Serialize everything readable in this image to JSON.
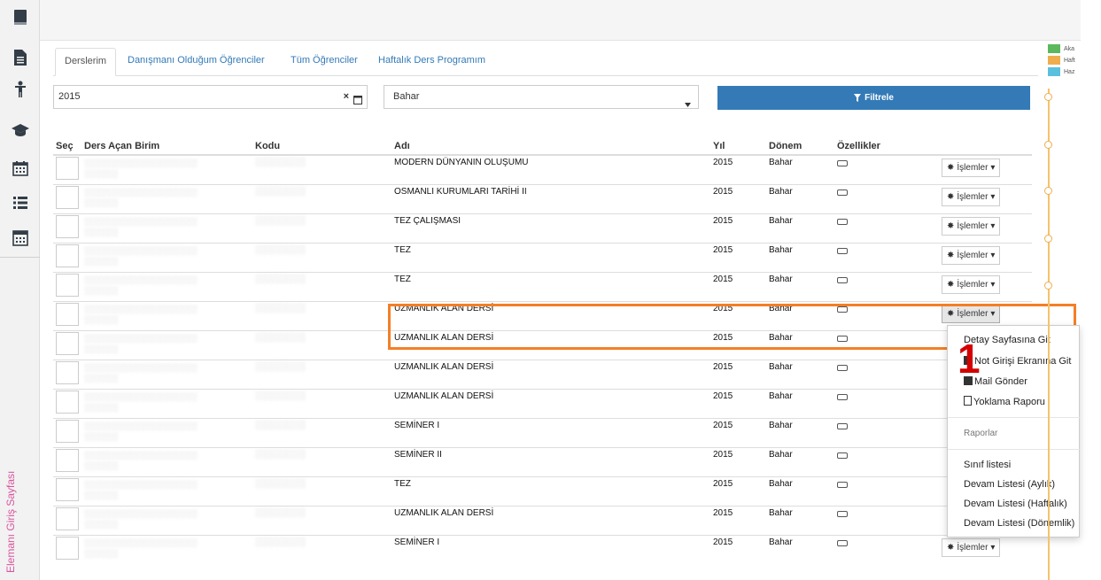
{
  "sidebar": {
    "icons": [
      "book-icon",
      "document-icon",
      "person-icon",
      "graduation-cap-icon",
      "calendar-icon",
      "list-icon",
      "calculator-icon"
    ],
    "vertical_label": "Elemanı Giriş Sayfası"
  },
  "tabs": [
    {
      "label": "Derslerim",
      "active": true
    },
    {
      "label": "Danışmanı Olduğum Öğrenciler",
      "active": false
    },
    {
      "label": "Tüm Öğrenciler",
      "active": false
    },
    {
      "label": "Haftalık Ders Programım",
      "active": false
    }
  ],
  "filters": {
    "year_value": "2015",
    "term_value": "Bahar",
    "filter_button_label": "Filtrele",
    "clear_symbol": "×"
  },
  "table": {
    "headers": {
      "select": "Seç",
      "unit": "Ders Açan Birim",
      "code": "Kodu",
      "name": "Adı",
      "year": "Yıl",
      "term": "Dönem",
      "features": "Özellikler"
    },
    "action_label": "İşlemler",
    "rows": [
      {
        "name": "MODERN DÜNYANIN OLUŞUMU",
        "year": "2015",
        "term": "Bahar",
        "show_action": true
      },
      {
        "name": "OSMANLI KURUMLARI TARİHİ II",
        "year": "2015",
        "term": "Bahar",
        "show_action": true
      },
      {
        "name": "TEZ ÇALIŞMASI",
        "year": "2015",
        "term": "Bahar",
        "show_action": true
      },
      {
        "name": "TEZ",
        "year": "2015",
        "term": "Bahar",
        "show_action": true
      },
      {
        "name": "TEZ",
        "year": "2015",
        "term": "Bahar",
        "show_action": true
      },
      {
        "name": "UZMANLIK ALAN DERSİ",
        "year": "2015",
        "term": "Bahar",
        "show_action": true,
        "open": true
      },
      {
        "name": "UZMANLIK ALAN DERSİ",
        "year": "2015",
        "term": "Bahar",
        "show_action": false
      },
      {
        "name": "UZMANLIK ALAN DERSİ",
        "year": "2015",
        "term": "Bahar",
        "show_action": false
      },
      {
        "name": "UZMANLIK ALAN DERSİ",
        "year": "2015",
        "term": "Bahar",
        "show_action": false
      },
      {
        "name": "SEMİNER I",
        "year": "2015",
        "term": "Bahar",
        "show_action": false
      },
      {
        "name": "SEMİNER II",
        "year": "2015",
        "term": "Bahar",
        "show_action": false
      },
      {
        "name": "TEZ",
        "year": "2015",
        "term": "Bahar",
        "show_action": false
      },
      {
        "name": "UZMANLIK ALAN DERSİ",
        "year": "2015",
        "term": "Bahar",
        "show_action": false
      },
      {
        "name": "SEMİNER I",
        "year": "2015",
        "term": "Bahar",
        "show_action": true
      }
    ]
  },
  "dropdown_menu": {
    "items": [
      "Detay Sayfasına Git",
      "Not Girişi Ekranına Git",
      "Mail Gönder",
      "Yoklama Raporu"
    ],
    "section_header": "Raporlar",
    "report_items": [
      "Sınıf listesi",
      "Devam Listesi (Aylık)",
      "Devam Listesi (Haftalık)",
      "Devam Listesi (Dönemlik)"
    ]
  },
  "annotation": {
    "number": "1",
    "color": "#f47f26"
  },
  "legend": [
    {
      "label": "Aka",
      "color": "#5cb85c"
    },
    {
      "label": "Haft",
      "color": "#f0ad4e"
    },
    {
      "label": "Haz",
      "color": "#5bc0de"
    }
  ],
  "colors": {
    "primary": "#337ab7",
    "accent": "#d9559d",
    "highlight": "#f47f26"
  }
}
